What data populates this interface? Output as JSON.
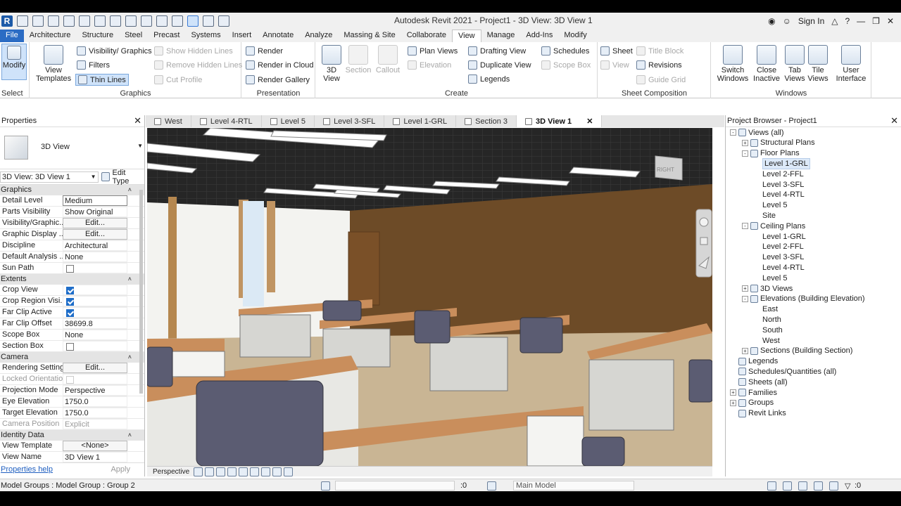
{
  "app": {
    "title": "Autodesk Revit 2021 - Project1 - 3D View: 3D View 1",
    "sign_in": "Sign In"
  },
  "ribbon_tabs": [
    "File",
    "Architecture",
    "Structure",
    "Steel",
    "Precast",
    "Systems",
    "Insert",
    "Annotate",
    "Analyze",
    "Massing & Site",
    "Collaborate",
    "View",
    "Manage",
    "Add-Ins",
    "Modify"
  ],
  "ribbon": {
    "select": {
      "modify": "Modify",
      "select": "Select"
    },
    "graphics": {
      "label": "Graphics",
      "view_templates": "View Templates",
      "vis_graphics": "Visibility/ Graphics",
      "filters": "Filters",
      "thin_lines": "Thin  Lines",
      "show_hidden": "Show  Hidden Lines",
      "remove_hidden": "Remove  Hidden Lines",
      "cut_profile": "Cut  Profile"
    },
    "presentation": {
      "label": "Presentation",
      "render": "Render",
      "render_cloud": "Render  in Cloud",
      "render_gallery": "Render  Gallery"
    },
    "create": {
      "label": "Create",
      "view3d": "3D View",
      "section": "Section",
      "callout": "Callout",
      "plan_views": "Plan  Views",
      "elevation": "Elevation",
      "drafting_view": "Drafting  View",
      "duplicate_view": "Duplicate  View",
      "legends": "Legends",
      "schedules": "Schedules",
      "scope_box": "Scope  Box"
    },
    "sheet": {
      "label": "Sheet Composition",
      "sheet": "Sheet",
      "title_block": "Title  Block",
      "view": "View",
      "revisions": "Revisions",
      "guide_grid": "Guide  Grid"
    },
    "windows": {
      "label": "Windows",
      "switch": "Switch Windows",
      "close_inactive": "Close Inactive",
      "tab_views": "Tab Views",
      "tile_views": "Tile Views",
      "user_interface": "User Interface"
    }
  },
  "properties": {
    "title": "Properties",
    "type_name": "3D View",
    "selector": "3D View: 3D View 1",
    "edit_type": "Edit Type",
    "groups": [
      {
        "name": "Graphics",
        "rows": [
          {
            "k": "Detail Level",
            "v": "Medium",
            "t": "box"
          },
          {
            "k": "Parts Visibility",
            "v": "Show Original"
          },
          {
            "k": "Visibility/Graphic...",
            "v": "Edit...",
            "t": "btn"
          },
          {
            "k": "Graphic Display ...",
            "v": "Edit...",
            "t": "btn"
          },
          {
            "k": "Discipline",
            "v": "Architectural"
          },
          {
            "k": "Default Analysis ...",
            "v": "None"
          },
          {
            "k": "Sun Path",
            "v": "",
            "t": "chk0"
          }
        ]
      },
      {
        "name": "Extents",
        "rows": [
          {
            "k": "Crop View",
            "v": "",
            "t": "chk1"
          },
          {
            "k": "Crop Region Visi...",
            "v": "",
            "t": "chk1"
          },
          {
            "k": "Far Clip Active",
            "v": "",
            "t": "chk1"
          },
          {
            "k": "Far Clip Offset",
            "v": "38699.8"
          },
          {
            "k": "Scope Box",
            "v": "None"
          },
          {
            "k": "Section Box",
            "v": "",
            "t": "chk0"
          }
        ]
      },
      {
        "name": "Camera",
        "rows": [
          {
            "k": "Rendering Settings",
            "v": "Edit...",
            "t": "btn"
          },
          {
            "k": "Locked Orientation",
            "v": "",
            "t": "chk0d"
          },
          {
            "k": "Projection Mode",
            "v": "Perspective"
          },
          {
            "k": "Eye Elevation",
            "v": "1750.0"
          },
          {
            "k": "Target Elevation",
            "v": "1750.0"
          },
          {
            "k": "Camera Position",
            "v": "Explicit",
            "t": "dim"
          }
        ]
      },
      {
        "name": "Identity Data",
        "rows": [
          {
            "k": "View Template",
            "v": "<None>",
            "t": "btn"
          },
          {
            "k": "View Name",
            "v": "3D View 1"
          }
        ]
      }
    ],
    "help": "Properties help",
    "apply": "Apply"
  },
  "view_tabs": [
    "West",
    "Level 4-RTL",
    "Level 5",
    "Level 3-SFL",
    "Level 1-GRL",
    "Section 3",
    "3D View 1"
  ],
  "view_control": {
    "projection": "Perspective"
  },
  "viewcube": {
    "face": "RIGHT"
  },
  "project_browser": {
    "title": "Project Browser - Project1",
    "nodes": [
      {
        "t": "Views (all)",
        "d": 0,
        "tog": "-"
      },
      {
        "t": "Structural Plans",
        "d": 1,
        "tog": "+"
      },
      {
        "t": "Floor Plans",
        "d": 1,
        "tog": "-"
      },
      {
        "t": "Level 1-GRL",
        "d": 2,
        "sel": true
      },
      {
        "t": "Level 2-FFL",
        "d": 2
      },
      {
        "t": "Level 3-SFL",
        "d": 2
      },
      {
        "t": "Level 4-RTL",
        "d": 2
      },
      {
        "t": "Level 5",
        "d": 2
      },
      {
        "t": "Site",
        "d": 2
      },
      {
        "t": "Ceiling Plans",
        "d": 1,
        "tog": "-"
      },
      {
        "t": "Level 1-GRL",
        "d": 2
      },
      {
        "t": "Level 2-FFL",
        "d": 2
      },
      {
        "t": "Level 3-SFL",
        "d": 2
      },
      {
        "t": "Level 4-RTL",
        "d": 2
      },
      {
        "t": "Level 5",
        "d": 2
      },
      {
        "t": "3D Views",
        "d": 1,
        "tog": "+"
      },
      {
        "t": "Elevations (Building Elevation)",
        "d": 1,
        "tog": "-"
      },
      {
        "t": "East",
        "d": 2
      },
      {
        "t": "North",
        "d": 2
      },
      {
        "t": "South",
        "d": 2
      },
      {
        "t": "West",
        "d": 2
      },
      {
        "t": "Sections (Building Section)",
        "d": 1,
        "tog": "+"
      },
      {
        "t": "Legends",
        "d": 0
      },
      {
        "t": "Schedules/Quantities (all)",
        "d": 0
      },
      {
        "t": "Sheets (all)",
        "d": 0
      },
      {
        "t": "Families",
        "d": 0,
        "tog": "+"
      },
      {
        "t": "Groups",
        "d": 0,
        "tog": "+"
      },
      {
        "t": "Revit Links",
        "d": 0
      }
    ]
  },
  "status": {
    "left": "Model Groups : Model Group : Group 2",
    "sel_count": ":0",
    "workset": "Main Model",
    "filter_count": ":0"
  }
}
